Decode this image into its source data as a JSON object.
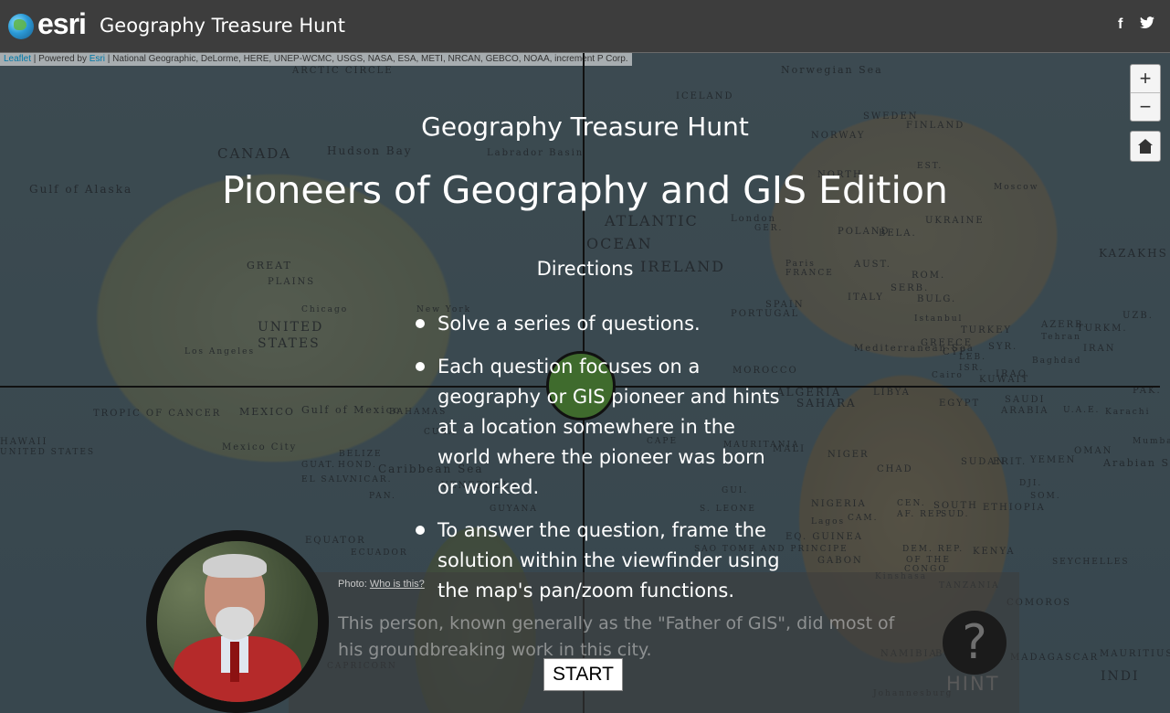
{
  "header": {
    "logo_text": "esri",
    "title": "Geography Treasure Hunt",
    "social": {
      "facebook": "f",
      "twitter": "t"
    }
  },
  "map": {
    "attribution": {
      "leaflet": "Leaflet",
      "powered_by": " | Powered by ",
      "esri": "Esri",
      "sources": " | National Geographic, DeLorme, HERE, UNEP-WCMC, USGS, NASA, ESA, METI, NRCAN, GEBCO, NOAA, increment P Corp."
    },
    "zoom_in": "+",
    "zoom_out": "−",
    "labels": [
      "ARCTIC CIRCLE",
      "Norwegian Sea",
      "ICELAND",
      "SWEDEN",
      "FINLAND",
      "NORWAY",
      "CANADA",
      "Hudson Bay",
      "Labrador Basin",
      "Gulf of Alaska",
      "EST.",
      "Moscow",
      "NORTH",
      "ATLANTIC",
      "OCEAN",
      "IRELAND",
      "London",
      "GER.",
      "POLAND",
      "BELA.",
      "UKRAINE",
      "KAZAKHS",
      "GREAT",
      "PLAINS",
      "Paris",
      "FRANCE",
      "AUST.",
      "ROM.",
      "SPAIN",
      "ITALY",
      "SERB.",
      "BULG.",
      "Istanbul",
      "TURKEY",
      "UZB.",
      "Chicago",
      "New York",
      "UNITED",
      "STATES",
      "PORTUGAL",
      "GREECE",
      "AZERB.",
      "TURKM.",
      "Los Angeles",
      "Tehran",
      "Mediterranean Sea",
      "SYR.",
      "IRAN",
      "CYP.",
      "LEB.",
      "ISR.",
      "IRAQ",
      "Baghdad",
      "MOROCCO",
      "Cairo",
      "TROPIC OF CANCER",
      "ALGERIA",
      "LIBYA",
      "KUWAIT",
      "MEXICO",
      "Gulf of Mexico",
      "SAHARA",
      "EGYPT",
      "SAUDI",
      "ARABIA",
      "U.A.E.",
      "Karachi",
      "PAK.",
      "BAHAMAS",
      "HAWAII",
      "Mumbai (Bombay)",
      "UNITED STATES",
      "CUBA",
      "Mexico City",
      "CAPE",
      "MAURITANIA",
      "MALI",
      "NIGER",
      "OMAN",
      "BELIZE",
      "HOND.",
      "Caribbean Sea",
      "SUDAN",
      "ERIT.",
      "YEMEN",
      "Arabian Sea",
      "GUAT.",
      "EL SALV.",
      "NICAR.",
      "CHAD",
      "DJI.",
      "PAN.",
      "VENEZUELA",
      "GUYANA",
      "GUI.",
      "SOM.",
      "NIGERIA",
      "ETHIOPIA",
      "S. LEONE",
      "CEN.",
      "AF. REP.",
      "SOUTH",
      "SUD.",
      "EQUATOR",
      "Lagos",
      "CAM.",
      "EQ. GUINEA",
      "ECUADOR",
      "DEM. REP.",
      "OF THE",
      "CONGO",
      "KENYA",
      "GABON",
      "SAO TOME AND PRINCIPE",
      "SEYCHELLES",
      "TANZANIA",
      "Kinshasa",
      "COMOROS",
      "NAMIBIA",
      "BOTS.",
      "MADAGASCAR",
      "MAURITIUS",
      "Johannesburg",
      "CAPRICORN",
      "INDI"
    ]
  },
  "intro": {
    "subtitle": "Geography Treasure Hunt",
    "title": "Pioneers of Geography and GIS Edition",
    "directions_heading": "Directions",
    "directions": [
      "Solve a series of questions.",
      "Each question focuses on a geography or GIS pioneer and hints at a location somewhere in the world where the pioneer was born or worked.",
      "To answer the question, frame the solution within the viewfinder using the map's pan/zoom functions."
    ],
    "start_label": "START"
  },
  "question": {
    "photo_label": "Photo:",
    "photo_link": "Who is this?",
    "text": "This person, known generally as the \"Father of GIS\", did most of his groundbreaking work in this city.",
    "hint_symbol": "?",
    "hint_label": "HINT"
  }
}
